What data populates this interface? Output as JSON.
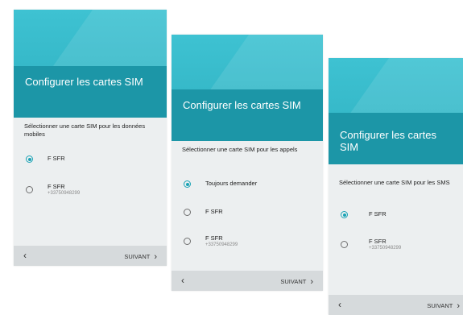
{
  "screens": [
    {
      "title": "Configurer les cartes SIM",
      "prompt": "Sélectionner une carte SIM pour les données mobiles",
      "options": [
        {
          "label": "F SFR",
          "sub": "",
          "selected": true
        },
        {
          "label": "F SFR",
          "sub": "+33750948299",
          "selected": false
        }
      ],
      "back_icon": "chevron-left-icon",
      "next_label": "SUIVANT",
      "next_icon": "chevron-right-icon"
    },
    {
      "title": "Configurer les cartes SIM",
      "prompt": "Sélectionner une carte SIM pour les appels",
      "options": [
        {
          "label": "Toujours demander",
          "sub": "",
          "selected": true
        },
        {
          "label": "F SFR",
          "sub": "",
          "selected": false
        },
        {
          "label": "F SFR",
          "sub": "+33750948299",
          "selected": false
        }
      ],
      "back_icon": "chevron-left-icon",
      "next_label": "SUIVANT",
      "next_icon": "chevron-right-icon"
    },
    {
      "title": "Configurer les cartes SIM",
      "prompt": "Sélectionner une carte SIM pour les SMS",
      "options": [
        {
          "label": "F SFR",
          "sub": "",
          "selected": true
        },
        {
          "label": "F SFR",
          "sub": "+33750948299",
          "selected": false
        }
      ],
      "back_icon": "chevron-left-icon",
      "next_label": "SUIVANT",
      "next_icon": "chevron-right-icon"
    }
  ],
  "colors": {
    "header": "#3ec2d2",
    "title_band": "#1c96a7",
    "accent": "#1aa3b5",
    "body_bg": "#eceff0",
    "nav_bg": "#d6dadc"
  }
}
